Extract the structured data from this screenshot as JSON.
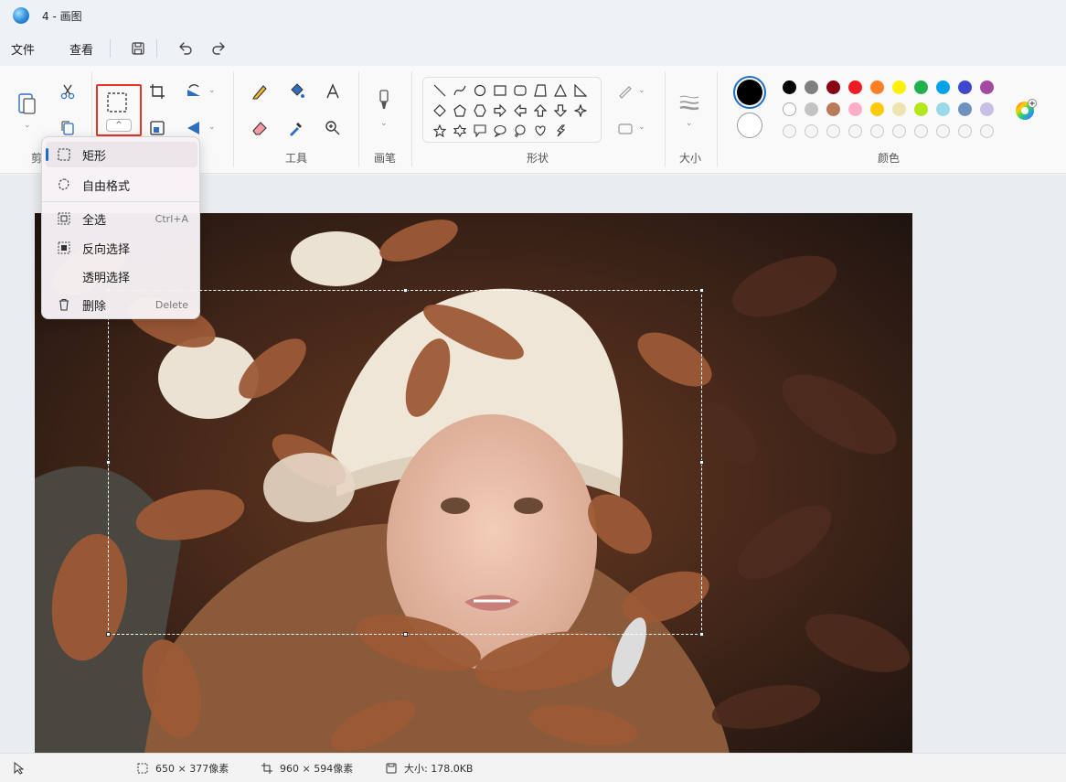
{
  "window": {
    "title": "4 - 画图"
  },
  "menu": {
    "file": "文件",
    "view": "查看"
  },
  "ribbon": {
    "clipboard_label_partial": "剪",
    "tools_label": "工具",
    "brushes_label": "画笔",
    "shapes_label": "形状",
    "size_label": "大小",
    "colors_label": "颜色"
  },
  "colors": {
    "primary": "#000000",
    "secondary": "#ffffff",
    "accent_highlight": "#e53524",
    "palette_row1": [
      "#000000",
      "#7f7f7f",
      "#880015",
      "#ed1c24",
      "#ff7f27",
      "#fff200",
      "#22b14c",
      "#00a2e8",
      "#3f48cc",
      "#a349a4"
    ],
    "palette_row2": [
      "#ffffff",
      "#c3c3c3",
      "#b97a57",
      "#ffaec9",
      "#ffc90e",
      "#efe4b0",
      "#b5e61d",
      "#99d9ea",
      "#7092be",
      "#c8bfe7"
    ]
  },
  "selection_menu": {
    "items": [
      {
        "label": "矩形",
        "icon": "rectangle-select-icon",
        "shortcut": ""
      },
      {
        "label": "自由格式",
        "icon": "freeform-select-icon",
        "shortcut": ""
      },
      {
        "label": "全选",
        "icon": "select-all-icon",
        "shortcut": "Ctrl+A"
      },
      {
        "label": "反向选择",
        "icon": "invert-selection-icon",
        "shortcut": ""
      },
      {
        "label": "透明选择",
        "icon": "",
        "shortcut": ""
      },
      {
        "label": "删除",
        "icon": "trash-icon",
        "shortcut": "Delete"
      }
    ]
  },
  "status": {
    "selection_size": "650 × 377像素",
    "image_size": "960 × 594像素",
    "file_size": "大小: 178.0KB"
  }
}
